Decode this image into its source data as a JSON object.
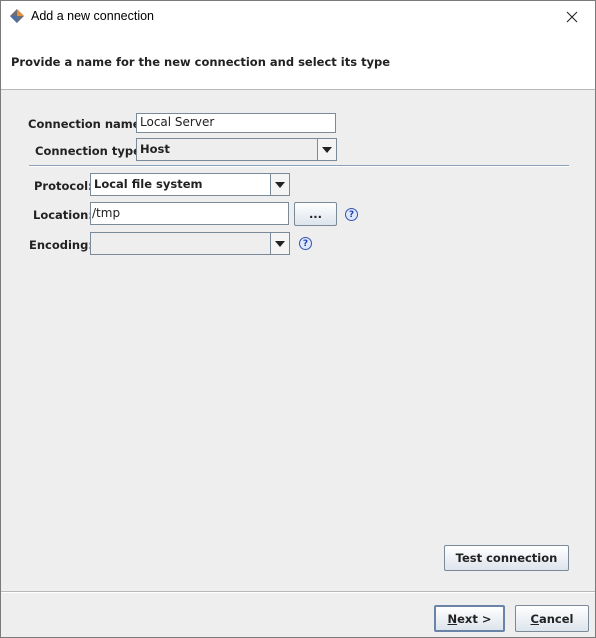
{
  "window": {
    "title": "Add a new connection"
  },
  "header": {
    "text": "Provide a name for the new connection and select its type"
  },
  "form": {
    "connection_name_label": "Connection name:",
    "connection_name_value": "Local Server",
    "connection_type_label": "Connection type:",
    "connection_type_value": "Host",
    "protocol_label": "Protocol:",
    "protocol_value": "Local file system",
    "location_label": "Location:",
    "location_value": "/tmp",
    "browse_label": "...",
    "encoding_label": "Encoding:",
    "encoding_value": "",
    "help_glyph": "?"
  },
  "buttons": {
    "test_connection": "Test connection",
    "next": "Next >",
    "next_mnemonic": "N",
    "next_rest": "ext >",
    "cancel_mnemonic": "C",
    "cancel_rest": "ancel"
  },
  "icons": {
    "app": "app-logo-icon",
    "close": "close-icon",
    "dropdown": "chevron-down-icon",
    "help": "help-icon"
  }
}
